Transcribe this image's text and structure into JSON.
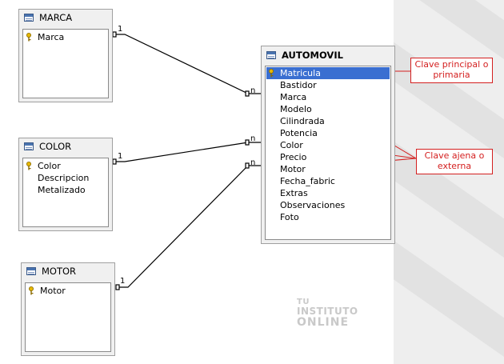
{
  "tables": {
    "marca": {
      "title": "MARCA",
      "fields": [
        "Marca"
      ]
    },
    "color": {
      "title": "COLOR",
      "fields": [
        "Color",
        "Descripcion",
        "Metalizado"
      ]
    },
    "motor": {
      "title": "MOTOR",
      "fields": [
        "Motor"
      ]
    },
    "automovil": {
      "title": "AUTOMOVIL",
      "fields": [
        "Matricula",
        "Bastidor",
        "Marca",
        "Modelo",
        "Cilindrada",
        "Potencia",
        "Color",
        "Precio",
        "Motor",
        "Fecha_fabric",
        "Extras",
        "Observaciones",
        "Foto"
      ],
      "selected_field": "Matricula"
    }
  },
  "relations": [
    {
      "from": "MARCA",
      "to": "AUTOMOVIL",
      "from_card": "1",
      "to_card": "n"
    },
    {
      "from": "COLOR",
      "to": "AUTOMOVIL",
      "from_card": "1",
      "to_card": "n"
    },
    {
      "from": "MOTOR",
      "to": "AUTOMOVIL",
      "from_card": "1",
      "to_card": "n"
    }
  ],
  "annotations": {
    "primary": "Clave principal o primaria",
    "foreign": "Clave ajena o externa"
  },
  "watermark": {
    "line1": "TU",
    "line2": "INSTITUTO",
    "line3": "ONLINE"
  },
  "colors": {
    "annotation": "#d42020",
    "selection": "#3a6fd1",
    "table_icon": "#4a74b0"
  },
  "icons": {
    "table": "table-icon",
    "key": "key-icon"
  }
}
